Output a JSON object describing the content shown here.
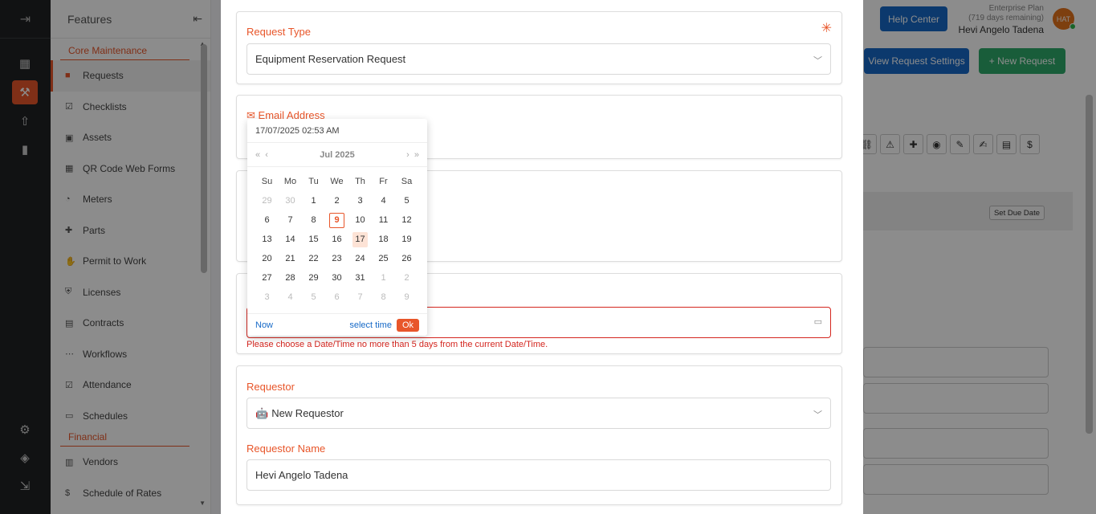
{
  "features": {
    "title": "Features",
    "sections": [
      {
        "label": "Core Maintenance",
        "items": [
          {
            "label": "Requests",
            "icon": "request-icon",
            "active": true
          },
          {
            "label": "Checklists",
            "icon": "checklist-icon"
          },
          {
            "label": "Assets",
            "icon": "asset-icon"
          },
          {
            "label": "QR Code Web Forms",
            "icon": "qr-icon"
          },
          {
            "label": "Meters",
            "icon": "meter-icon"
          },
          {
            "label": "Parts",
            "icon": "puzzle-icon"
          },
          {
            "label": "Permit to Work",
            "icon": "hand-icon"
          },
          {
            "label": "Licenses",
            "icon": "shield-icon"
          },
          {
            "label": "Contracts",
            "icon": "contract-icon"
          },
          {
            "label": "Workflows",
            "icon": "workflow-icon"
          },
          {
            "label": "Attendance",
            "icon": "attendance-icon"
          },
          {
            "label": "Schedules",
            "icon": "calendar-icon"
          }
        ]
      },
      {
        "label": "Financial",
        "items": [
          {
            "label": "Vendors",
            "icon": "vendor-icon"
          },
          {
            "label": "Schedule of Rates",
            "icon": "dollar-icon"
          }
        ]
      }
    ]
  },
  "header": {
    "help": "Help Center",
    "plan": "Enterprise Plan",
    "days": "(719 days remaining)",
    "user": "Hevi Angelo Tadena",
    "initials": "HAT",
    "view_settings": "View Request Settings",
    "new_request": "+ New Request",
    "set_due": "Set Due Date"
  },
  "modal": {
    "request_type_label": "Request Type",
    "request_type_value": "Equipment Reservation Request",
    "email_label": "Email Address",
    "error": "Please choose a Date/Time no more than 5 days from the current Date/Time.",
    "requestor_label": "Requestor",
    "requestor_value": "New Requestor",
    "requestor_name_label": "Requestor Name",
    "requestor_name_value": "Hevi Angelo Tadena"
  },
  "picker": {
    "input": "17/07/2025 02:53 AM",
    "month": "Jul 2025",
    "weekdays": [
      "Su",
      "Mo",
      "Tu",
      "We",
      "Th",
      "Fr",
      "Sa"
    ],
    "weeks": [
      [
        "29",
        "30",
        "1",
        "2",
        "3",
        "4",
        "5"
      ],
      [
        "6",
        "7",
        "8",
        "9",
        "10",
        "11",
        "12"
      ],
      [
        "13",
        "14",
        "15",
        "16",
        "17",
        "18",
        "19"
      ],
      [
        "20",
        "21",
        "22",
        "23",
        "24",
        "25",
        "26"
      ],
      [
        "27",
        "28",
        "29",
        "30",
        "31",
        "1",
        "2"
      ],
      [
        "3",
        "4",
        "5",
        "6",
        "7",
        "8",
        "9"
      ]
    ],
    "today": "9",
    "selected": "17",
    "now": "Now",
    "select_time": "select time",
    "ok": "Ok"
  }
}
